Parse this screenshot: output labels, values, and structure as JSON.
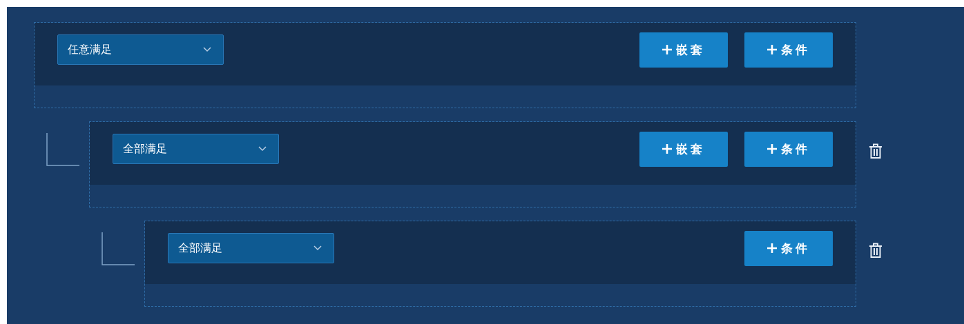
{
  "groups": [
    {
      "match": "任意满足",
      "deletable": false,
      "buttons": [
        {
          "label": "嵌套"
        },
        {
          "label": "条件"
        }
      ],
      "children": [
        {
          "match": "全部满足",
          "deletable": true,
          "buttons": [
            {
              "label": "嵌套"
            },
            {
              "label": "条件"
            }
          ],
          "children": [
            {
              "match": "全部满足",
              "deletable": true,
              "buttons": [
                {
                  "label": "条件"
                }
              ]
            }
          ]
        }
      ]
    }
  ]
}
